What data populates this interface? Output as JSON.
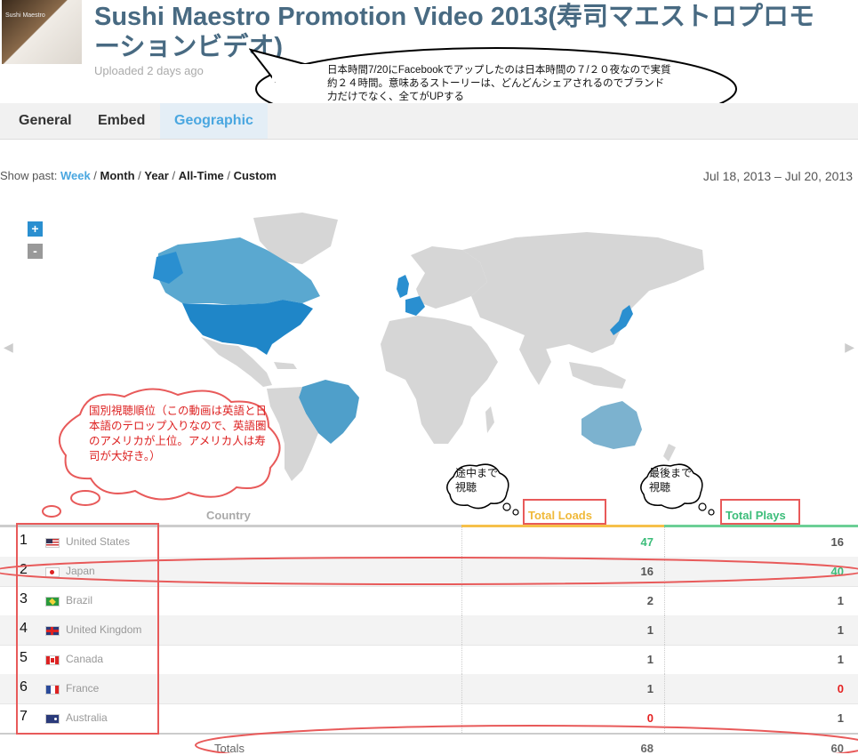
{
  "header": {
    "title": "Sushi Maestro Promotion Video 2013(寿司マエストロプロモーションビデオ)",
    "uploaded": "Uploaded 2 days ago",
    "thumbnail_caption": "Sushi Maestro"
  },
  "callout": {
    "text": "日本時間7/20にFacebookでアップしたのは日本時間の７/２０夜なので実質約２４時間。意味あるストーリーは、どんどんシェアされるのでブランド力だけでなく、全てがUPする"
  },
  "tabs": [
    {
      "label": "General"
    },
    {
      "label": "Embed"
    },
    {
      "label": "Geographic",
      "active": true
    }
  ],
  "filter": {
    "label": "Show past:",
    "options": [
      "Week",
      "Month",
      "Year",
      "All-Time",
      "Custom"
    ],
    "selected": "Week",
    "date_range": "Jul 18, 2013 – Jul 20, 2013"
  },
  "map": {
    "zoom_in": "+",
    "zoom_out": "-",
    "highlight_color": "#2a8fd0",
    "land_color": "#d6d6d6"
  },
  "annotations": {
    "cloud": "国別視聴順位（この動画は英語と日本語のテロップ入りなので、英語圏のアメリカが上位。アメリカ人は寿司が大好き。）",
    "loads_note": "途中まで視聴",
    "plays_note": "最後まで視聴"
  },
  "table": {
    "columns": {
      "country": "Country",
      "loads": "Total Loads",
      "plays": "Total Plays"
    },
    "rows": [
      {
        "rank": "1",
        "country": "United States",
        "loads": "47",
        "plays": "16"
      },
      {
        "rank": "2",
        "country": "Japan",
        "loads": "16",
        "plays": "40"
      },
      {
        "rank": "3",
        "country": "Brazil",
        "loads": "2",
        "plays": "1"
      },
      {
        "rank": "4",
        "country": "United Kingdom",
        "loads": "1",
        "plays": "1"
      },
      {
        "rank": "5",
        "country": "Canada",
        "loads": "1",
        "plays": "1"
      },
      {
        "rank": "6",
        "country": "France",
        "loads": "1",
        "plays": "0"
      },
      {
        "rank": "7",
        "country": "Australia",
        "loads": "0",
        "plays": "1"
      }
    ],
    "totals": {
      "label": "Totals",
      "loads": "68",
      "plays": "60"
    }
  }
}
